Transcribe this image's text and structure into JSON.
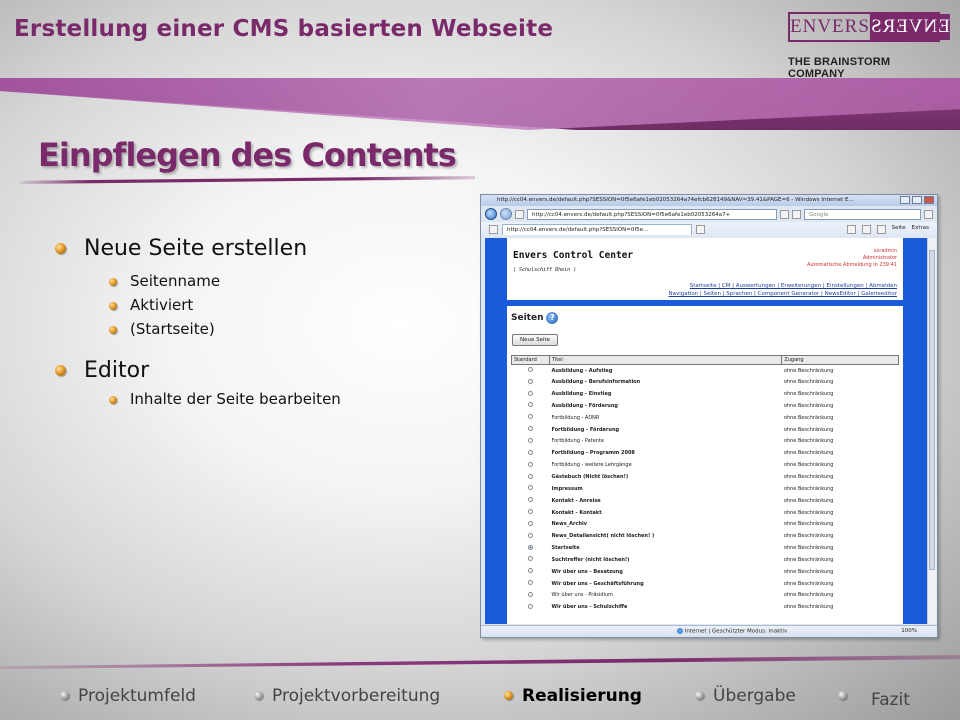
{
  "header": {
    "title": "Erstellung einer CMS basierten Webseite",
    "logo_left": "ENVERS",
    "logo_right": "ENVERS",
    "logo_tagline": "THE BRAINSTORM COMPANY"
  },
  "section": {
    "title": "Einpflegen des Contents"
  },
  "bullets": [
    {
      "text": "Neue Seite erstellen",
      "children": [
        "Seitenname",
        "Aktiviert",
        "(Startseite)"
      ]
    },
    {
      "text": "Editor",
      "children": [
        "Inhalte der Seite bearbeiten"
      ]
    }
  ],
  "screenshot": {
    "window_title": "http://cc04.envers.de/default.php?SESSION=0f5e6afe1eb02053264a74efcb628149&NAV=39.41&PAGE=6 - Windows Internet E...",
    "url": "http://cc04.envers.de/default.php?SESSION=0f5e6afe1eb02053264a7+",
    "search_placeholder": "Google",
    "tab_label": "http://cc04.envers.de/default.php?SESSION=0f5e...",
    "toolbar_page": "Seite",
    "toolbar_extras": "Extras",
    "app_title": "Envers Control Center",
    "app_subtitle": "( Schulschiff Rhein )",
    "user_name": "sxradmin",
    "user_role": "Administrator",
    "auto_logout": "Automatische Abmeldung in 239:41",
    "links_row1": "Startseite | CM | Auswertungen | Erweiterungen | Einstellungen | Abmelden",
    "links_row2": "Navigation | Seiten | Sprachen | Component Generator | NewsEditor | Galerieeditor",
    "section_label": "Seiten",
    "help_icon_label": "?",
    "new_page_button": "Neue Seite",
    "columns": [
      "Standard",
      "Titel",
      "Zugang"
    ],
    "rows": [
      {
        "title": "Ausbildung - Aufstieg",
        "access": "ohne Beschränkung",
        "bold": true,
        "selected": false
      },
      {
        "title": "Ausbildung - Berufsinformation",
        "access": "ohne Beschränkung",
        "bold": true,
        "selected": false
      },
      {
        "title": "Ausbildung - Einstieg",
        "access": "ohne Beschränkung",
        "bold": true,
        "selected": false
      },
      {
        "title": "Ausbildung - Förderung",
        "access": "ohne Beschränkung",
        "bold": true,
        "selected": false
      },
      {
        "title": "Fortbildung - ADNR",
        "access": "ohne Beschränkung",
        "bold": false,
        "selected": false
      },
      {
        "title": "Fortbildung - Förderung",
        "access": "ohne Beschränkung",
        "bold": true,
        "selected": false
      },
      {
        "title": "Fortbildung - Patente",
        "access": "ohne Beschränkung",
        "bold": false,
        "selected": false
      },
      {
        "title": "Fortbildung - Programm 2008",
        "access": "ohne Beschränkung",
        "bold": true,
        "selected": false
      },
      {
        "title": "Fortbildung - weitere Lehrgänge",
        "access": "ohne Beschränkung",
        "bold": false,
        "selected": false
      },
      {
        "title": "Gästebuch (Nicht löschen!)",
        "access": "ohne Beschränkung",
        "bold": true,
        "selected": false
      },
      {
        "title": "Impressum",
        "access": "ohne Beschränkung",
        "bold": true,
        "selected": false
      },
      {
        "title": "Kontakt - Anreise",
        "access": "ohne Beschränkung",
        "bold": true,
        "selected": false
      },
      {
        "title": "Kontakt - Kontakt",
        "access": "ohne Beschränkung",
        "bold": true,
        "selected": false
      },
      {
        "title": "News_Archiv",
        "access": "ohne Beschränkung",
        "bold": true,
        "selected": false
      },
      {
        "title": "News_Detailansicht( nicht löschen! )",
        "access": "ohne Beschränkung",
        "bold": true,
        "selected": false
      },
      {
        "title": "Startseite",
        "access": "ohne Beschränkung",
        "bold": true,
        "selected": true
      },
      {
        "title": "Suchtreffer (nicht löschen!)",
        "access": "ohne Beschränkung",
        "bold": true,
        "selected": false
      },
      {
        "title": "Wir über uns - Besatzung",
        "access": "ohne Beschränkung",
        "bold": true,
        "selected": false
      },
      {
        "title": "Wir über uns - Geschäftsführung",
        "access": "ohne Beschränkung",
        "bold": true,
        "selected": false
      },
      {
        "title": "Wir über uns - Präsidium",
        "access": "ohne Beschränkung",
        "bold": false,
        "selected": false
      },
      {
        "title": "Wir über uns - Schulschiffe",
        "access": "ohne Beschränkung",
        "bold": true,
        "selected": false
      }
    ],
    "status_text": "Internet | Geschützter Modus: Inaktiv",
    "zoom": "100%"
  },
  "footer_nav": [
    {
      "label": "Projektumfeld",
      "active": false
    },
    {
      "label": "Projektvorbereitung",
      "active": false
    },
    {
      "label": "Realisierung",
      "active": true
    },
    {
      "label": "Übergabe",
      "active": false
    },
    {
      "label": "Fazit",
      "active": false
    }
  ],
  "colors": {
    "accent": "#7a2a6a",
    "bullet": "#e39b2a",
    "browser_blue": "#1a5bd9"
  }
}
